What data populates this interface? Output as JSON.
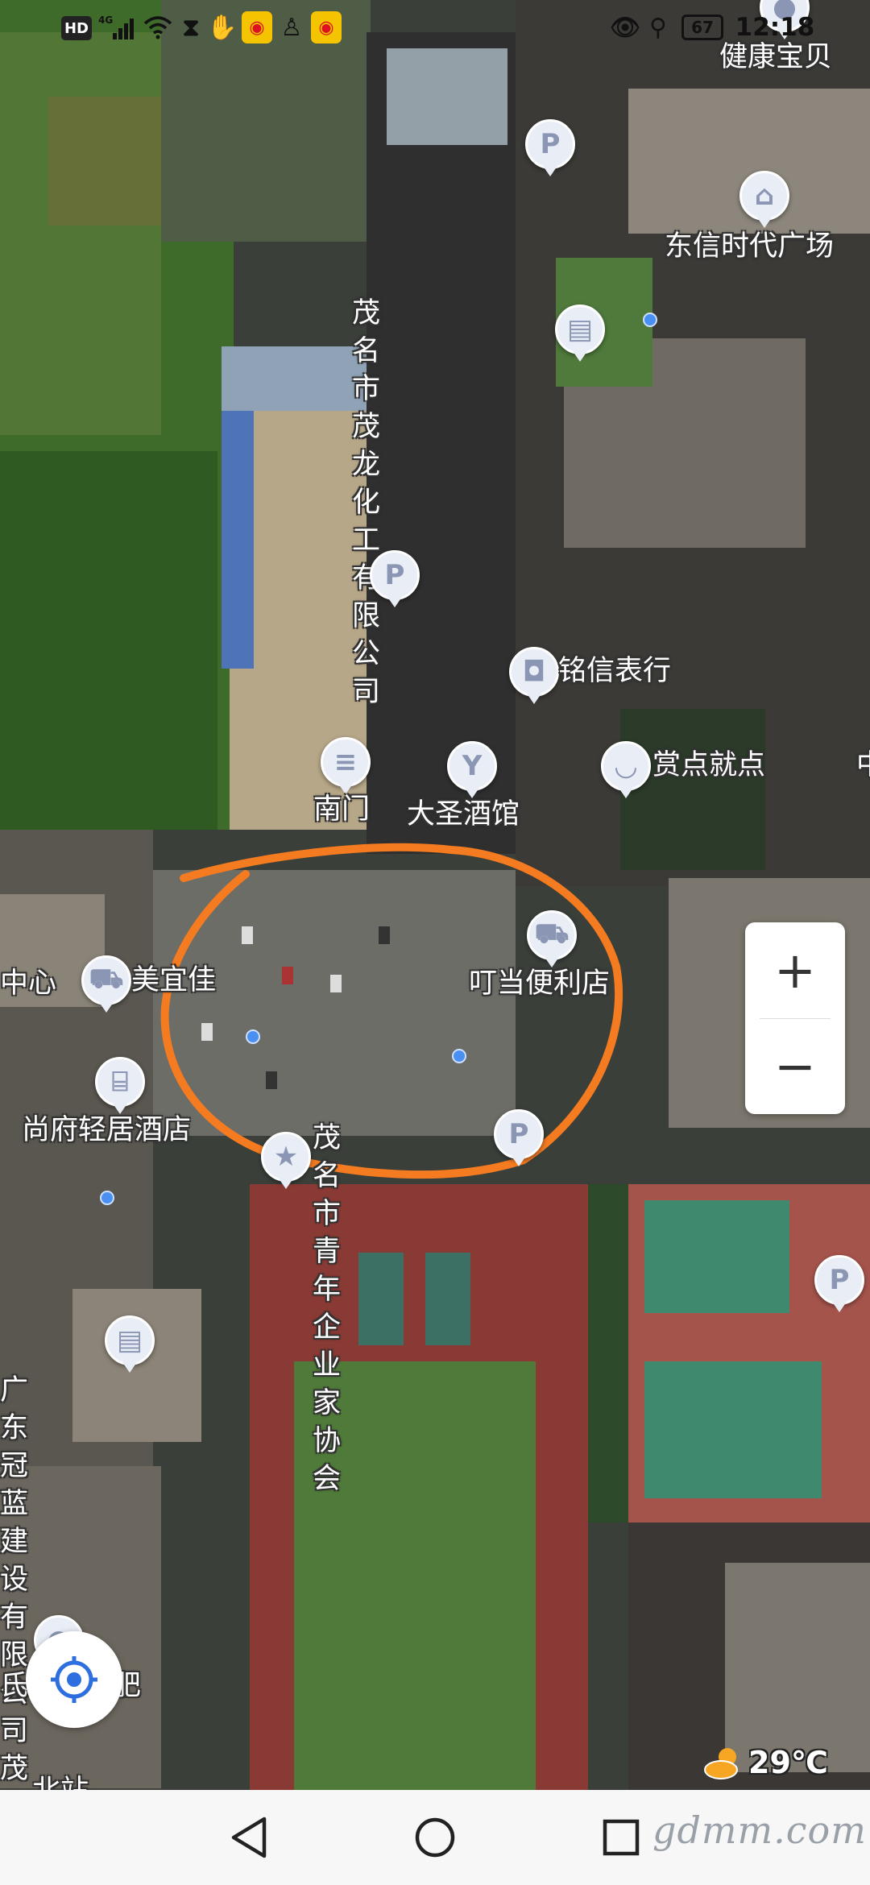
{
  "status_bar": {
    "time": "12:18",
    "battery": "67",
    "network": "4G",
    "hd": "HD"
  },
  "map": {
    "pois": [
      {
        "id": "jiankang",
        "label": "健康宝贝",
        "icon": "pin-icon"
      },
      {
        "id": "parking1",
        "label": "",
        "icon": "parking-icon"
      },
      {
        "id": "dongxin",
        "label": "东信时代广场",
        "icon": "landmark-icon"
      },
      {
        "id": "maolong",
        "label": "茂名市茂龙\n化工有限公司",
        "icon": "building-icon"
      },
      {
        "id": "parking2",
        "label": "",
        "icon": "parking-icon"
      },
      {
        "id": "mingxin",
        "label": "铭信表行",
        "icon": "shopping-bag-icon"
      },
      {
        "id": "nanmen",
        "label": "南门",
        "icon": "gate-icon"
      },
      {
        "id": "dasheng",
        "label": "大圣酒馆",
        "icon": "bar-icon"
      },
      {
        "id": "shangdian",
        "label": "赏点就点",
        "icon": "restaurant-icon"
      },
      {
        "id": "zhong",
        "label": "中",
        "icon": ""
      },
      {
        "id": "meiyijia",
        "label": "美宜佳",
        "icon": "cart-icon"
      },
      {
        "id": "zhongxin",
        "label": "中心",
        "icon": ""
      },
      {
        "id": "dingdang",
        "label": "叮当便利店",
        "icon": "cart-icon"
      },
      {
        "id": "shangfu",
        "label": "尚府轻居酒店",
        "icon": "hotel-icon"
      },
      {
        "id": "qingnian",
        "label": "茂名市青年\n企业家协会",
        "icon": "organization-icon"
      },
      {
        "id": "parking3",
        "label": "",
        "icon": "parking-icon"
      },
      {
        "id": "parking4",
        "label": "",
        "icon": "parking-icon"
      },
      {
        "id": "guanlan",
        "label": "广东冠蓝建设有限\n公司茂名分公司",
        "icon": "building-icon"
      },
      {
        "id": "jianfei",
        "label": "氏纤姿减肥",
        "icon": "pin-icon"
      },
      {
        "id": "bottom",
        "label": "北站",
        "icon": ""
      }
    ]
  },
  "zoom": {
    "in_label": "+",
    "out_label": "−"
  },
  "weather": {
    "temperature": "29℃",
    "icon": "cloud-sun-icon"
  },
  "watermark": "gdmm.com",
  "colors": {
    "annotation": "#f47b20",
    "poi_fill": "#e9edf6",
    "locate_blue": "#2e6fe0"
  }
}
